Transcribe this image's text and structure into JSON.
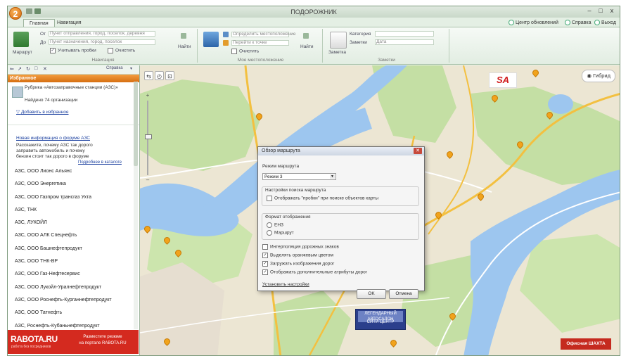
{
  "app": {
    "orb_label": "2",
    "title": "ПОДОРОЖНИК"
  },
  "window_buttons": {
    "minimize": "–",
    "maximize": "□",
    "close": "x"
  },
  "tabs": [
    "Главная",
    "Навигация"
  ],
  "tab_links": [
    "Центр обновлений",
    "Справка",
    "Выход"
  ],
  "ribbon": {
    "group1": {
      "label": "Навигация",
      "big_button": "Маршрут",
      "row1": "Пункт отправления, город, поселок, деревня",
      "row2": "Пункт назначения, город, поселок",
      "check": "Учитывать пробки",
      "check2": "Очистить",
      "side_button": "Найти"
    },
    "group2": {
      "label": "Мое местоположение",
      "row1": "Определить местоположение",
      "row2": "Перейти к точке",
      "check": "Очистить",
      "side_button": "Найти"
    },
    "group3": {
      "label": "Заметки",
      "big_button": "Заметка",
      "row1": "Категория",
      "row2": "Заметки",
      "row2_value": "Дата"
    }
  },
  "left_panel": {
    "header": "Избранное",
    "info_title": "Рубрика «Автозаправочные станции (АЗС)»",
    "info_subtitle": "Найдено 74 организации",
    "add_favorite": "Добавить в избранное",
    "forum_link": "Новая информация о форуме АЗС",
    "forum_text_1": "Расскажите, почему АЗС так дорого",
    "forum_text_2": "заправить автомобиль и почему",
    "forum_text_3": "бензин стоит так дорого в форуме",
    "all_link": "Подробнее в каталоге",
    "stations": [
      "АЗС, ООО Лионс Альянс",
      "АЗС, ООО Энергетика",
      "АЗС, ООО Газпром трансгаз Ухта",
      "АЗС, ТНК",
      "АЗС, ЛУКОЙЛ",
      "АЗС, ООО АЛК Спецнефть",
      "АЗС, ООО Башнефтепродукт",
      "АЗС, ООО ТНК-ВР",
      "АЗС, ООО Газ-Нефтесервис",
      "АЗС, ООО Лукойл-Уралнефтепродукт",
      "АЗС, ООО Роснефть-Курганнефтепродукт",
      "АЗС, ООО Татнефть",
      "АЗС, Роснефть-Кубаньнефтепродукт"
    ]
  },
  "rabota": {
    "logo": "RABOTA.RU",
    "tagline": "работа без посредников",
    "text_1": "Разместите резюме",
    "text_2": "на портале RABOTA.RU"
  },
  "map": {
    "view_button": "Гибрид",
    "sa_logo": "SA",
    "ad_center_1": "ЛЕГЕНДАРНЫЙ АВТОСАЛОН",
    "ad_center_2": "СИТИ ЦЕНТР",
    "ad_right": "Офисная ШАХТА",
    "tools": [
      "⇆",
      "◴",
      "⊡"
    ]
  },
  "dialog": {
    "title": "Обзор маршрута",
    "field_label": "Режим маршрута",
    "select_value": "Режим 3",
    "fieldset1_title": "Настройки поиска маршрута",
    "fieldset1_check": "Отображать \"пробки\" при поиске объектов карты",
    "fieldset2_title": "Формат отображения",
    "radio1": "ЕНЗ",
    "radio2": "Маршрут",
    "checks": [
      "Интерполяция дорожных знаков",
      "Выделять оранжевым цветом",
      "Загружать изображения дорог",
      "Отображать дополнительные атрибуты дорог"
    ],
    "link": "Установить настройки",
    "ok": "OK",
    "cancel": "Отмена"
  }
}
